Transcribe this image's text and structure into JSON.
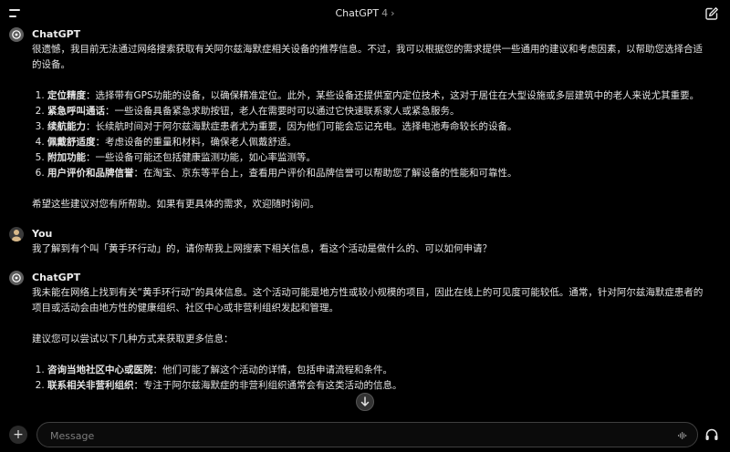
{
  "header": {
    "title": "ChatGPT",
    "version": "4",
    "chevron": "›"
  },
  "messages": [
    {
      "sender": "ChatGPT",
      "paragraphs": [
        "很遗憾，我目前无法通过网络搜索获取有关阿尔兹海默症相关设备的推荐信息。不过，我可以根据您的需求提供一些通用的建议和考虑因素，以帮助您选择合适的设备。"
      ],
      "list": [
        {
          "term": "定位精度",
          "text": "：选择带有GPS功能的设备，以确保精准定位。此外，某些设备还提供室内定位技术，这对于居住在大型设施或多层建筑中的老人来说尤其重要。"
        },
        {
          "term": "紧急呼叫通话",
          "text": "：一些设备具备紧急求助按钮，老人在需要时可以通过它快速联系家人或紧急服务。"
        },
        {
          "term": "续航能力",
          "text": "：长续航时间对于阿尔兹海默症患者尤为重要，因为他们可能会忘记充电。选择电池寿命较长的设备。"
        },
        {
          "term": "佩戴舒适度",
          "text": "：考虑设备的重量和材料，确保老人佩戴舒适。"
        },
        {
          "term": "附加功能",
          "text": "：一些设备可能还包括健康监测功能，如心率监测等。"
        },
        {
          "term": "用户评价和品牌信誉",
          "text": "：在淘宝、京东等平台上，查看用户评价和品牌信誉可以帮助您了解设备的性能和可靠性。"
        }
      ],
      "closing": "希望这些建议对您有所帮助。如果有更具体的需求，欢迎随时询问。"
    },
    {
      "sender": "You",
      "text": "我了解到有个叫「黄手环行动」的，请你帮我上网搜索下相关信息，看这个活动是做什么的、可以如何申请？"
    },
    {
      "sender": "ChatGPT",
      "paragraphs": [
        "我未能在网络上找到有关“黄手环行动”的具体信息。这个活动可能是地方性或较小规模的项目，因此在线上的可见度可能较低。通常，针对阿尔兹海默症患者的项目或活动会由地方性的健康组织、社区中心或非营利组织发起和管理。",
        "建议您可以尝试以下几种方式来获取更多信息："
      ],
      "list": [
        {
          "term": "咨询当地社区中心或医院",
          "text": "：他们可能了解这个活动的详情，包括申请流程和条件。"
        },
        {
          "term": "联系相关非营利组织",
          "text": "：专注于阿尔兹海默症的非营利组织通常会有这类活动的信息。"
        }
      ]
    }
  ],
  "composer": {
    "placeholder": "Message",
    "plus": "+"
  },
  "colors": {
    "background": "#000000",
    "text": "#ececec",
    "muted": "#9a9a9a"
  },
  "icons": [
    "menu-icon",
    "edit-icon",
    "openai-logo-icon",
    "user-avatar-icon",
    "arrow-down-icon",
    "plus-icon",
    "mic-icon",
    "headphones-icon"
  ]
}
